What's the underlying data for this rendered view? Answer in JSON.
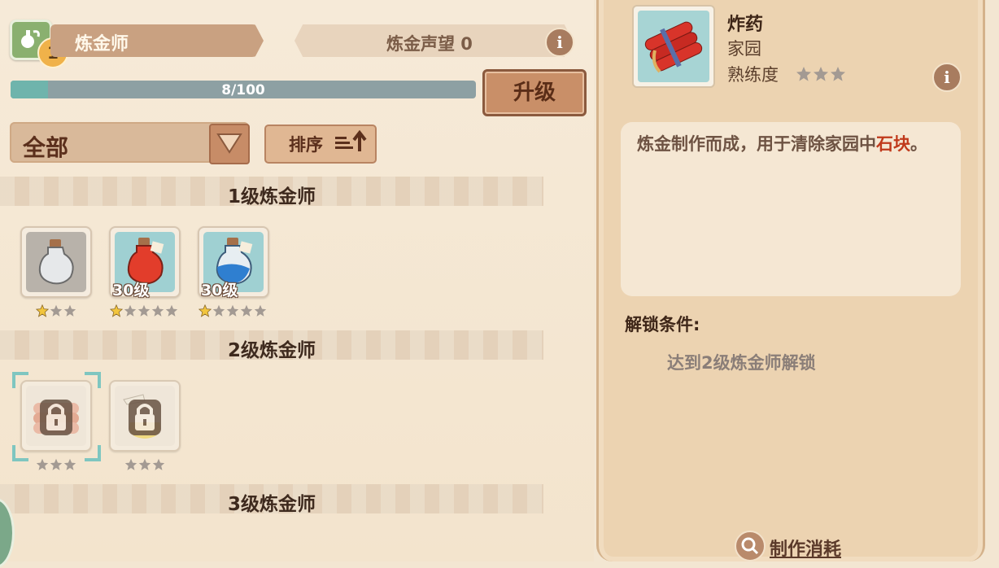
{
  "header": {
    "class_name": "炼金师",
    "class_level": "1",
    "reputation_label": "炼金声望 0",
    "progress_text": "8/100",
    "progress_fraction": 0.08,
    "upgrade_label": "升级"
  },
  "filter": {
    "selected": "全部",
    "sort_label": "排序"
  },
  "sections": [
    {
      "title": "1级炼金师",
      "items": [
        {
          "icon": "empty-flask-icon",
          "level_label": "",
          "stars_filled": 1,
          "stars_total": 3,
          "locked": false
        },
        {
          "icon": "red-potion-icon",
          "level_label": "30级",
          "stars_filled": 1,
          "stars_total": 5,
          "locked": false
        },
        {
          "icon": "blue-potion-icon",
          "level_label": "30级",
          "stars_filled": 1,
          "stars_total": 5,
          "locked": false
        }
      ]
    },
    {
      "title": "2级炼金师",
      "items": [
        {
          "icon": "dynamite-icon",
          "level_label": "",
          "stars_filled": 0,
          "stars_total": 3,
          "locked": true,
          "selected": true
        },
        {
          "icon": "spray-bottle-icon",
          "level_label": "",
          "stars_filled": 0,
          "stars_total": 3,
          "locked": true
        }
      ]
    },
    {
      "title": "3级炼金师",
      "items": []
    }
  ],
  "detail": {
    "name": "炸药",
    "category": "家园",
    "proficiency_label": "熟练度",
    "proficiency_stars": 0,
    "description_main": "炼金制作而成，用于清除家园中",
    "description_highlight": "石块",
    "description_end": "。",
    "unlock_label": "解锁条件:",
    "unlock_condition": "达到2级炼金师解锁",
    "cost_button_label": "制作消耗"
  },
  "colors": {
    "accent_brown": "#c98f68",
    "progress_fill": "#6fb4ac",
    "highlight_red": "#c0391b",
    "star_gold": "#f2c53d",
    "star_grey": "#a39a93"
  }
}
